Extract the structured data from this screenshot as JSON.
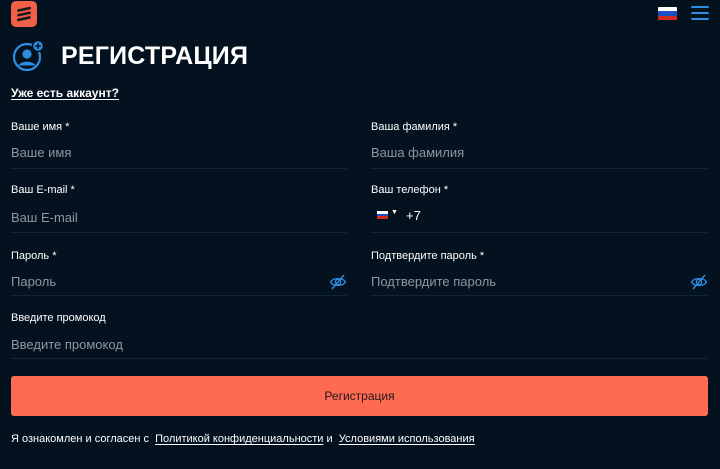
{
  "header": {
    "logo_icon": "brand-logo-icon",
    "language_flag": "russia-flag-icon",
    "menu_icon": "hamburger-menu-icon"
  },
  "page": {
    "title": "РЕГИСТРАЦИЯ",
    "title_icon": "user-add-icon",
    "login_link": "Уже есть аккаунт?"
  },
  "form": {
    "first_name": {
      "label": "Ваше имя *",
      "placeholder": "Ваше имя"
    },
    "last_name": {
      "label": "Ваша фамилия *",
      "placeholder": "Ваша фамилия"
    },
    "email": {
      "label": "Ваш E-mail *",
      "placeholder": "Ваш E-mail"
    },
    "phone": {
      "label": "Ваш телефон *",
      "country_code": "+7",
      "country_flag": "russia-flag-icon"
    },
    "password": {
      "label": "Пароль *",
      "placeholder": "Пароль",
      "toggle_icon": "eye-hidden-icon"
    },
    "confirm_password": {
      "label": "Подтвердите пароль *",
      "placeholder": "Подтвердите пароль",
      "toggle_icon": "eye-hidden-icon"
    },
    "promo": {
      "label": "Введите промокод",
      "placeholder": "Введите промокод"
    },
    "submit_label": "Регистрация"
  },
  "agreement": {
    "prefix": "Я ознакомлен и согласен с",
    "privacy_link": "Политикой конфиденциальности",
    "conjunction": "и",
    "terms_link": "Условиями использования"
  },
  "colors": {
    "background": "#041220",
    "accent": "#ff6a52",
    "icon_blue": "#2d8ee0",
    "placeholder": "#8e97a2"
  }
}
